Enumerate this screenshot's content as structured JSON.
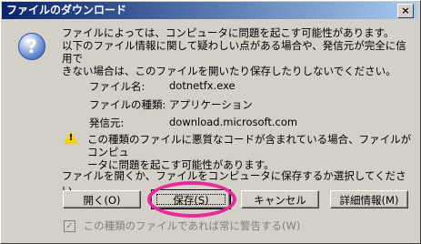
{
  "window": {
    "title": "ファイルのダウンロード",
    "close_glyph": "×"
  },
  "icons": {
    "question": "?",
    "warning": "!",
    "check": "✓"
  },
  "message": {
    "line1": "ファイルによっては、コンピュータに問題を起こす可能性があります。",
    "line2": "以下のファイル情報に関して疑わしい点がある場合や、発信元が完全に信用で",
    "line3": "きない場合は、このファイルを開いたり保存したりしないでください。"
  },
  "file_info": {
    "name_label": "ファイル名:",
    "name_value": "dotnetfx.exe",
    "type_label": "ファイルの種類:",
    "type_value": "アプリケーション",
    "source_label": "発信元:",
    "source_value": "download.microsoft.com"
  },
  "warning": {
    "line1": "この種類のファイルに悪質なコードが含まれている場合、ファイルがコンピュ",
    "line2": "ータに問題を起こす可能性があります。"
  },
  "prompt": "ファイルを開くか、ファイルをコンピュータに保存するか選択してください。",
  "buttons": {
    "open": "開く(O)",
    "save": "保存(S)",
    "cancel": "キャンセル",
    "details": "詳細情報(M)"
  },
  "checkbox": {
    "label": "この種類のファイルであれば常に警告する(W)",
    "checked": true
  },
  "colors": {
    "highlight": "#e62a9a",
    "titlebar": "#0a246a"
  }
}
